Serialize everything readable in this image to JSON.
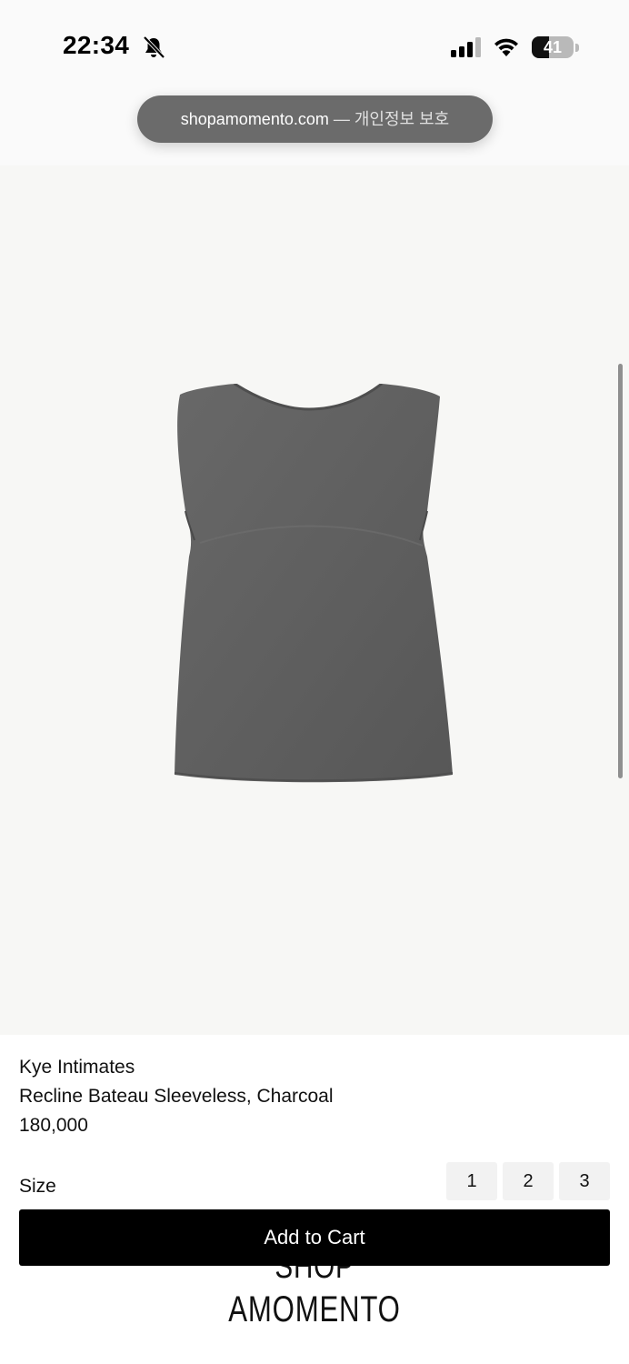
{
  "status_bar": {
    "time": "22:34",
    "battery_level": "41",
    "battery_percent": 41,
    "icons": [
      "bell-slash-icon",
      "cellular-signal-icon",
      "wifi-icon",
      "battery-icon"
    ]
  },
  "browser": {
    "domain": "shopamomento.com",
    "suffix": " — 개인정보 보호"
  },
  "product": {
    "image_icon": "sleeveless-top-image",
    "brand": "Kye Intimates",
    "name": "Recline Bateau Sleeveless, Charcoal",
    "price": "180,000"
  },
  "size_selector": {
    "label": "Size",
    "options": [
      "1",
      "2",
      "3"
    ]
  },
  "cart": {
    "add_label": "Add to Cart"
  },
  "logo": {
    "line1": "SHOP",
    "line2": "AMOMENTO"
  },
  "colors": {
    "button": "#000000",
    "garment": "#5f5f5f",
    "image_background": "#f7f7f5",
    "url_pill": "#6b6b6b"
  }
}
